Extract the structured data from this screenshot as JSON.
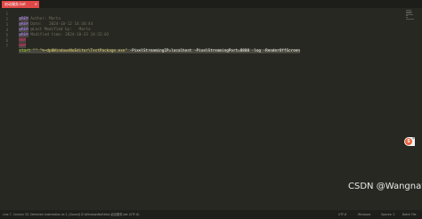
{
  "tab": {
    "label": "启动服务.bat",
    "close": "×"
  },
  "gutter": [
    "1",
    "2",
    "3",
    "4",
    "5",
    "6",
    "7"
  ],
  "code": {
    "line1": {
      "kw": "@REM",
      "text": " Author: Marta"
    },
    "line2": {
      "kw": "@REM",
      "text": " Date:   2024-10-12 14:34:44"
    },
    "line3": {
      "kw": "@REM",
      "text": " @Last Modified by:   Marta"
    },
    "line4": {
      "kw": "@REM",
      "text": " Modified time: 2024-10-23 14:32:03"
    },
    "line5": {
      "kw": "REM"
    },
    "line6": {
      "kw": "REM"
    },
    "line7": {
      "cmd": "start",
      "str": " \"\" \"%~dp0WindowsNoEditor\\TestPackage.exe\"",
      "args": " -PixelStreamingIP=localhost -PixelStreamingPort=8888 -log -RenderOffScreen"
    }
  },
  "side_widget": {
    "logo": "S",
    "label": "中"
  },
  "statusbar": {
    "left": "Line 7, Column 32; Detected indentation as 2; [Saved] D:\\WindowsNoEditor\\启动服务.bat (UTF-8)",
    "encoding": "UTF-8",
    "line_endings": "Windows",
    "indent": "Spaces: 2",
    "syntax": "Batch File"
  },
  "watermark": "CSDN @Wangnaya",
  "colors": {
    "tab_active": "#e04848",
    "editor_bg": "#272822",
    "keyword": "#ae81ff",
    "comment": "#75715e",
    "string": "#e6db74"
  }
}
